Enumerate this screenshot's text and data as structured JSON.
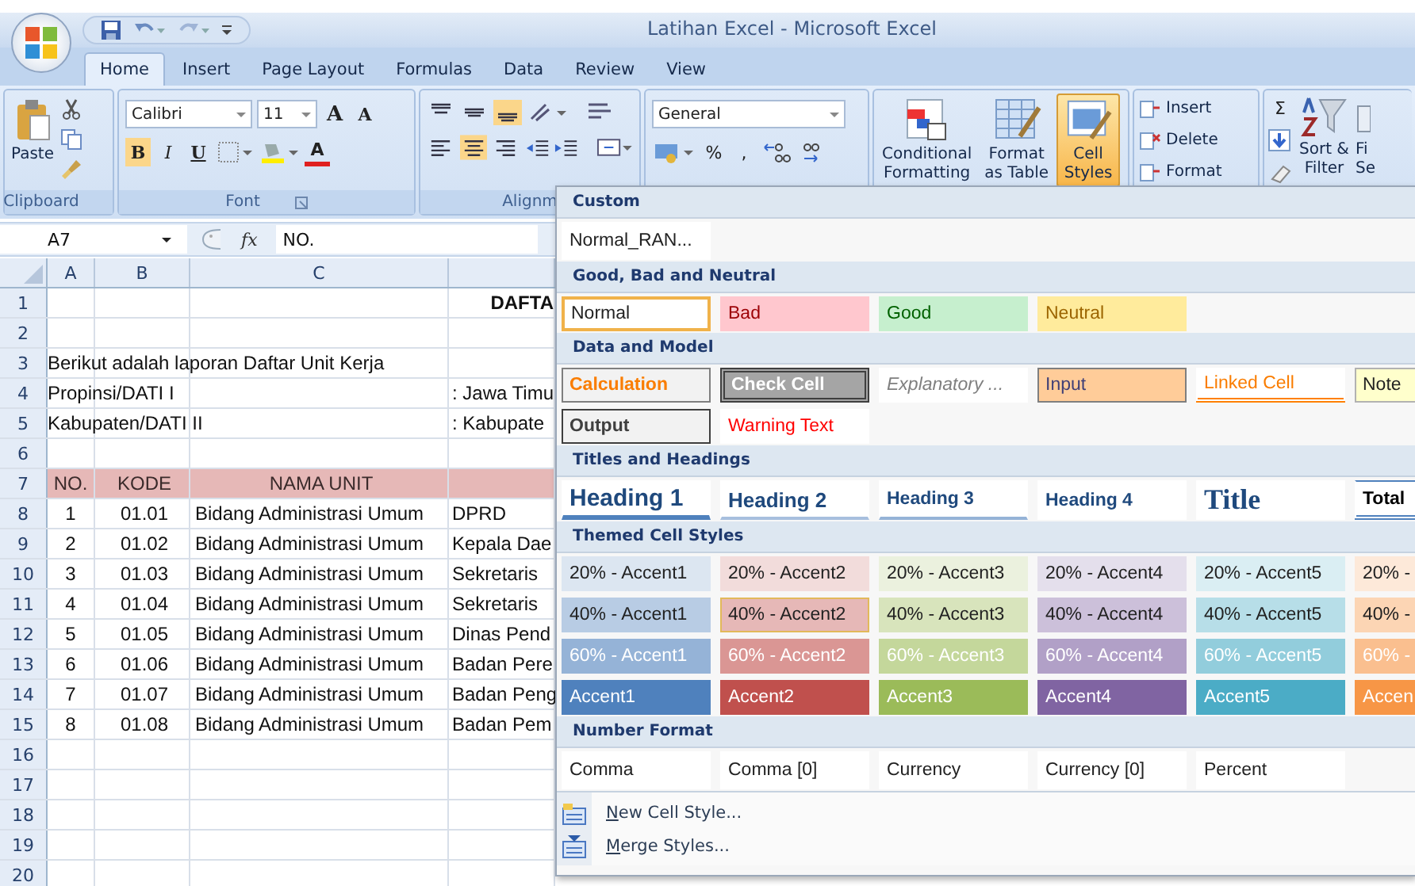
{
  "window": {
    "title": "Latihan Excel - Microsoft Excel"
  },
  "tabs": [
    {
      "label": "Home",
      "selected": true
    },
    {
      "label": "Insert",
      "selected": false
    },
    {
      "label": "Page Layout",
      "selected": false
    },
    {
      "label": "Formulas",
      "selected": false
    },
    {
      "label": "Data",
      "selected": false
    },
    {
      "label": "Review",
      "selected": false
    },
    {
      "label": "View",
      "selected": false
    }
  ],
  "ribbon": {
    "clipboard": {
      "label": "Clipboard",
      "paste": "Paste"
    },
    "font": {
      "label": "Font",
      "font_name": "Calibri",
      "font_size": "11",
      "grow": "A",
      "shrink": "A",
      "bold": "B",
      "italic": "I",
      "underline": "U",
      "font_color": "A"
    },
    "alignment": {
      "label": "Alignm"
    },
    "number": {
      "format": "General",
      "percent": "%",
      "comma": ","
    },
    "styles": [
      {
        "lines": [
          "Conditional",
          "Formatting"
        ],
        "kind": "conditional",
        "selected": false
      },
      {
        "lines": [
          "Format",
          "as Table"
        ],
        "kind": "table",
        "selected": false
      },
      {
        "lines": [
          "Cell",
          "Styles"
        ],
        "kind": "cellstyles",
        "selected": true
      }
    ],
    "cells": [
      "Insert",
      "Delete",
      "Format"
    ],
    "editing": {
      "sum": "Σ",
      "sort": [
        "Sort &",
        "Filter"
      ],
      "find": [
        "Fi",
        "Se"
      ]
    }
  },
  "formula_bar": {
    "name_box": "A7",
    "fx": "fx",
    "value": "NO."
  },
  "sheet": {
    "columns": [
      "A",
      "B",
      "C",
      ""
    ],
    "rows": [
      {
        "num": "1",
        "header": false,
        "cells": [
          "",
          "",
          "",
          "DAFTA"
        ]
      },
      {
        "num": "2",
        "header": false,
        "cells": [
          "",
          "",
          "",
          ""
        ]
      },
      {
        "num": "3",
        "header": false,
        "cells": [
          "Berikut adalah laporan Daftar Unit Kerja",
          "",
          "",
          ""
        ]
      },
      {
        "num": "4",
        "header": false,
        "cells": [
          "Propinsi/DATI I",
          "",
          "",
          ": Jawa Timu"
        ]
      },
      {
        "num": "5",
        "header": false,
        "cells": [
          "Kabupaten/DATI II",
          "",
          "",
          ": Kabupate"
        ]
      },
      {
        "num": "6",
        "header": false,
        "cells": [
          "",
          "",
          "",
          ""
        ]
      },
      {
        "num": "7",
        "header": true,
        "cells": [
          "NO.",
          "KODE",
          "NAMA UNIT",
          ""
        ]
      },
      {
        "num": "8",
        "header": false,
        "cells": [
          "1",
          "01.01",
          "Bidang Administrasi Umum",
          "DPRD"
        ]
      },
      {
        "num": "9",
        "header": false,
        "cells": [
          "2",
          "01.02",
          "Bidang Administrasi Umum",
          "Kepala Dae"
        ]
      },
      {
        "num": "10",
        "header": false,
        "cells": [
          "3",
          "01.03",
          "Bidang Administrasi Umum",
          "Sekretaris"
        ]
      },
      {
        "num": "11",
        "header": false,
        "cells": [
          "4",
          "01.04",
          "Bidang Administrasi Umum",
          "Sekretaris"
        ]
      },
      {
        "num": "12",
        "header": false,
        "cells": [
          "5",
          "01.05",
          "Bidang Administrasi Umum",
          "Dinas Pend"
        ]
      },
      {
        "num": "13",
        "header": false,
        "cells": [
          "6",
          "01.06",
          "Bidang Administrasi Umum",
          "Badan Pere"
        ]
      },
      {
        "num": "14",
        "header": false,
        "cells": [
          "7",
          "01.07",
          "Bidang Administrasi Umum",
          "Badan Peng"
        ]
      },
      {
        "num": "15",
        "header": false,
        "cells": [
          "8",
          "01.08",
          "Bidang Administrasi Umum",
          "Badan Pem"
        ]
      },
      {
        "num": "16",
        "header": false,
        "cells": [
          "",
          "",
          "",
          ""
        ]
      },
      {
        "num": "17",
        "header": false,
        "cells": [
          "",
          "",
          "",
          ""
        ]
      },
      {
        "num": "18",
        "header": false,
        "cells": [
          "",
          "",
          "",
          ""
        ]
      },
      {
        "num": "19",
        "header": false,
        "cells": [
          "",
          "",
          "",
          ""
        ]
      },
      {
        "num": "20",
        "header": false,
        "cells": [
          "",
          "",
          "",
          ""
        ]
      }
    ]
  },
  "cell_styles_gallery": {
    "sections": [
      {
        "title": "Custom",
        "rows": [
          [
            {
              "label": "Normal_RAN...",
              "kind": "plain"
            }
          ]
        ]
      },
      {
        "title": "Good, Bad and Neutral",
        "rows": [
          [
            {
              "label": "Normal",
              "kind": "normal",
              "selected": true
            },
            {
              "label": "Bad",
              "kind": "bad",
              "selected": false
            },
            {
              "label": "Good",
              "kind": "good",
              "selected": false
            },
            {
              "label": "Neutral",
              "kind": "neutral",
              "selected": false
            }
          ]
        ]
      },
      {
        "title": "Data and Model",
        "rows": [
          [
            {
              "label": "Calculation",
              "kind": "calculation"
            },
            {
              "label": "Check Cell",
              "kind": "check"
            },
            {
              "label": "Explanatory ...",
              "kind": "explanatory"
            },
            {
              "label": "Input",
              "kind": "input"
            },
            {
              "label": "Linked Cell",
              "kind": "linked"
            },
            {
              "label": "Note",
              "kind": "note"
            }
          ],
          [
            {
              "label": "Output",
              "kind": "output"
            },
            {
              "label": "Warning Text",
              "kind": "warning"
            }
          ]
        ]
      },
      {
        "title": "Titles and Headings",
        "rows": [
          [
            {
              "label": "Heading 1",
              "kind": "h1"
            },
            {
              "label": "Heading 2",
              "kind": "h2"
            },
            {
              "label": "Heading 3",
              "kind": "h3"
            },
            {
              "label": "Heading 4",
              "kind": "h4"
            },
            {
              "label": "Title",
              "kind": "title"
            },
            {
              "label": "Total",
              "kind": "total"
            }
          ]
        ]
      },
      {
        "title": "Themed Cell Styles",
        "rows": [
          [
            {
              "label": "20% - Accent1",
              "kind": "tint",
              "color": "#dce6f1",
              "hovered": false
            },
            {
              "label": "20% - Accent2",
              "kind": "tint",
              "color": "#f2dcdb",
              "hovered": false
            },
            {
              "label": "20% - Accent3",
              "kind": "tint",
              "color": "#ebf1de",
              "hovered": false
            },
            {
              "label": "20% - Accent4",
              "kind": "tint",
              "color": "#e4dfec",
              "hovered": false
            },
            {
              "label": "20% - Accent5",
              "kind": "tint",
              "color": "#daeef3",
              "hovered": false
            },
            {
              "label": "20% -",
              "kind": "tint",
              "color": "#fde9d9",
              "hovered": false
            }
          ],
          [
            {
              "label": "40% - Accent1",
              "kind": "tint",
              "color": "#b8cce4",
              "hovered": false
            },
            {
              "label": "40% - Accent2",
              "kind": "tint",
              "color": "#e6b8b7",
              "hovered": true
            },
            {
              "label": "40% - Accent3",
              "kind": "tint",
              "color": "#d8e4bc",
              "hovered": false
            },
            {
              "label": "40% - Accent4",
              "kind": "tint",
              "color": "#ccc0da",
              "hovered": false
            },
            {
              "label": "40% - Accent5",
              "kind": "tint",
              "color": "#b7dee8",
              "hovered": false
            },
            {
              "label": "40% -",
              "kind": "tint",
              "color": "#fcd5b4",
              "hovered": false
            }
          ],
          [
            {
              "label": "60% - Accent1",
              "kind": "fill",
              "color": "#95b3d7",
              "hovered": false
            },
            {
              "label": "60% - Accent2",
              "kind": "fill",
              "color": "#da9694",
              "hovered": false
            },
            {
              "label": "60% - Accent3",
              "kind": "fill",
              "color": "#c4d79b",
              "hovered": false
            },
            {
              "label": "60% - Accent4",
              "kind": "fill",
              "color": "#b1a0c7",
              "hovered": false
            },
            {
              "label": "60% - Accent5",
              "kind": "fill",
              "color": "#92cddc",
              "hovered": false
            },
            {
              "label": "60% -",
              "kind": "fill",
              "color": "#fabf8f",
              "hovered": false
            }
          ],
          [
            {
              "label": "Accent1",
              "kind": "fill",
              "color": "#4f81bd",
              "hovered": false
            },
            {
              "label": "Accent2",
              "kind": "fill",
              "color": "#c0504d",
              "hovered": false
            },
            {
              "label": "Accent3",
              "kind": "fill",
              "color": "#9bbb59",
              "hovered": false
            },
            {
              "label": "Accent4",
              "kind": "fill",
              "color": "#8064a2",
              "hovered": false
            },
            {
              "label": "Accent5",
              "kind": "fill",
              "color": "#4bacc6",
              "hovered": false
            },
            {
              "label": "Accen",
              "kind": "fill",
              "color": "#f79646",
              "hovered": false
            }
          ]
        ]
      },
      {
        "title": "Number Format",
        "rows": [
          [
            {
              "label": "Comma",
              "kind": "plain"
            },
            {
              "label": "Comma [0]",
              "kind": "plain"
            },
            {
              "label": "Currency",
              "kind": "plain"
            },
            {
              "label": "Currency [0]",
              "kind": "plain"
            },
            {
              "label": "Percent",
              "kind": "plain"
            }
          ]
        ]
      }
    ],
    "actions": [
      {
        "label": "New Cell Style...",
        "kind": "new"
      },
      {
        "label": "Merge Styles...",
        "kind": "merge"
      }
    ]
  }
}
